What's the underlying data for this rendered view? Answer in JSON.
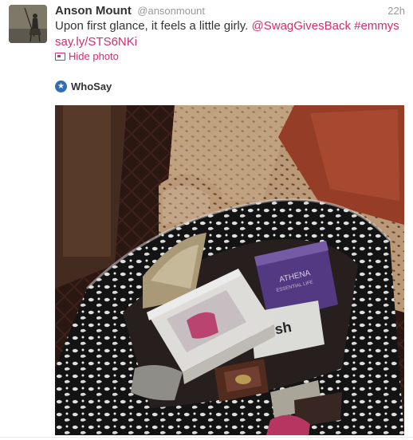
{
  "tweet": {
    "fullname": "Anson Mount",
    "username": "@ansonmount",
    "timestamp": "22h",
    "text_plain": "Upon first glance, it feels a little girly. ",
    "mention": "@SwagGivesBack",
    "hashtag": "#emmys",
    "link": "say.ly/STS6NKi",
    "hide_photo_label": "Hide photo",
    "source_name": "WhoSay"
  },
  "photo_box_text": {
    "athena_brand": "ATHENA",
    "athena_sub": "ESSENTIAL LIFE",
    "kish": "kish"
  },
  "colors": {
    "link": "#d12d6f",
    "name": "#333333",
    "meta": "#999999",
    "whosay": "#2f6db5"
  },
  "icons": {
    "hide_photo": "photo-icon",
    "source": "whosay-star-icon"
  }
}
